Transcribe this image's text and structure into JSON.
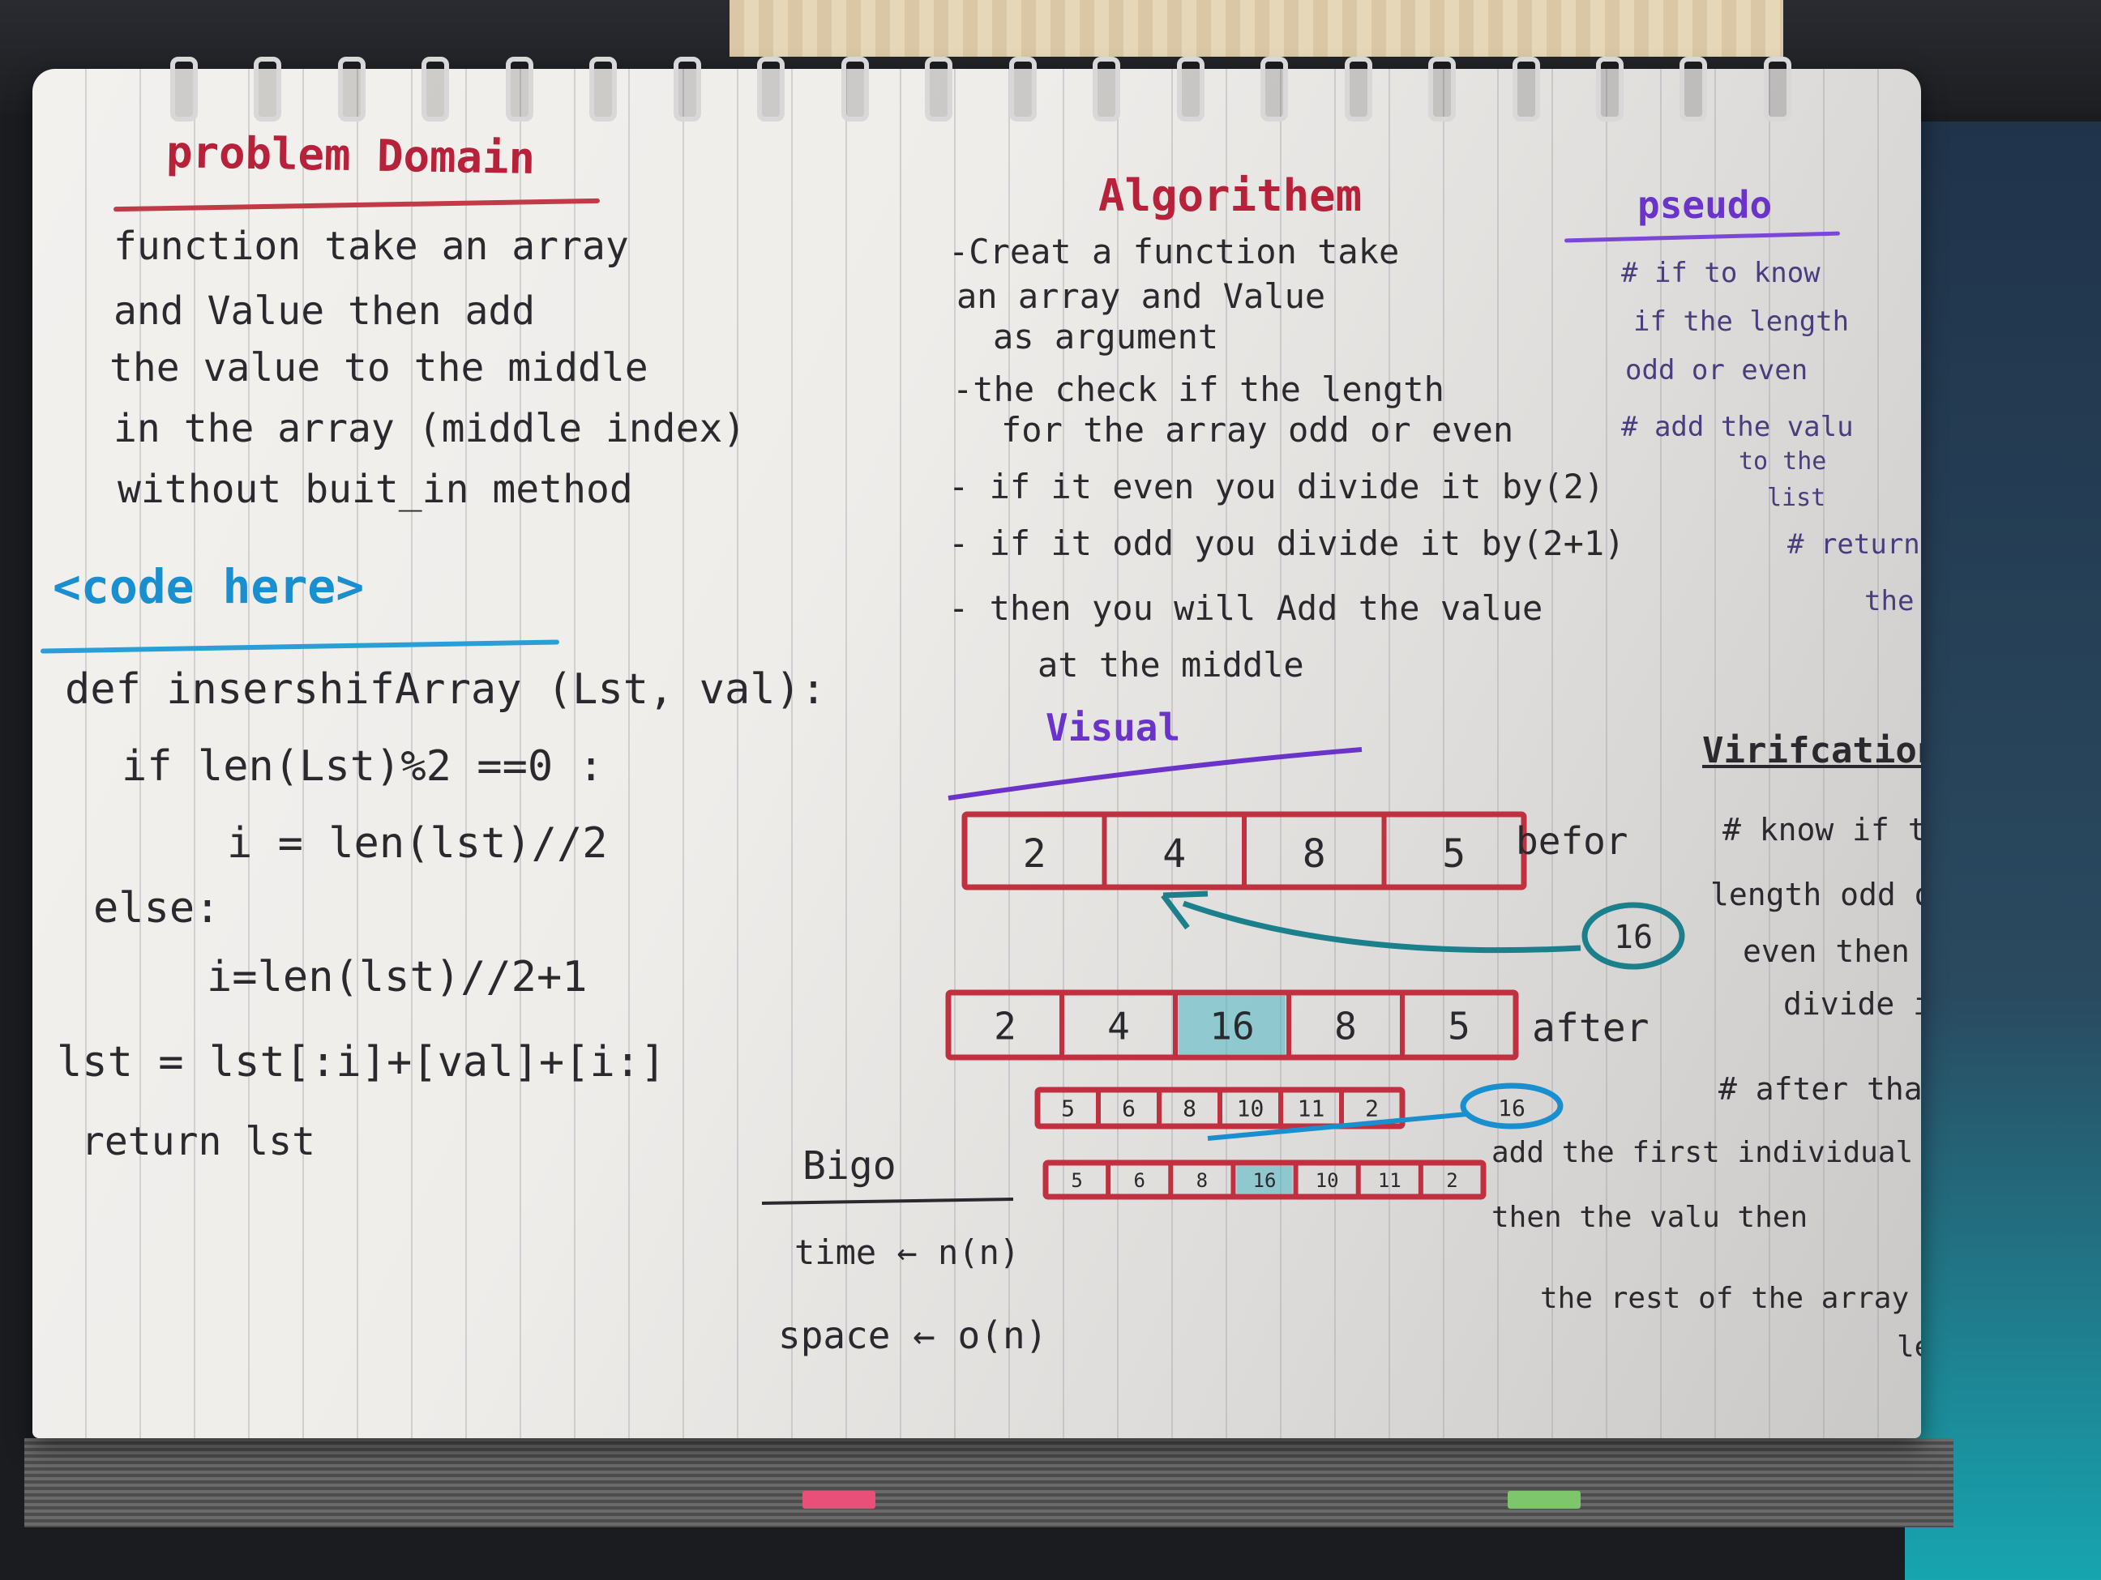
{
  "headings": {
    "problem": "problem Domain",
    "algorithm": "Algorithem",
    "pseudo": "pseudo",
    "code": "<code here>",
    "visual": "Visual",
    "verification": "Virifcation",
    "bigo": "Bigo"
  },
  "problem_lines": [
    "function take an array",
    "and Value then add",
    "the value to the middle",
    "in the array (middle index)",
    "without buit_in method"
  ],
  "code_lines": [
    "def insershifArray (Lst, val):",
    "if len(Lst)%2 ==0 :",
    "i = len(lst)//2",
    "else:",
    "i=len(lst)//2+1",
    "lst = lst[:i]+[val]+[i:]",
    "return lst"
  ],
  "algorithm_lines": [
    "-Creat a function take",
    "an array and Value",
    "as argument",
    "-the check if the length",
    "for the array odd or even",
    "- if it even you divide it by(2)",
    "- if it odd you divide it by(2+1)",
    "- then you will Add the value",
    "at the middle"
  ],
  "pseudo_lines": [
    "# if to know",
    "if the length",
    "odd or even",
    "# add the valu",
    "to the",
    "list",
    "# return",
    "the arr"
  ],
  "verification_lines": [
    "# know if the",
    "length odd or",
    "even then",
    "divide it",
    "# after that",
    "add the first individual",
    "then the valu then",
    "the rest of the array",
    "length"
  ],
  "visual": {
    "before_cells": [
      "2",
      "4",
      "8",
      "5"
    ],
    "after_cells": [
      "2",
      "4",
      "16",
      "8",
      "5"
    ],
    "insert_value": "16",
    "before_label": "befor",
    "after_label": "after",
    "small_before_cells": [
      "5",
      "6",
      "8",
      "10",
      "11",
      "2"
    ],
    "small_insert_value": "16",
    "small_after_cells": [
      "5",
      "6",
      "8",
      "16",
      "10",
      "11",
      "2"
    ]
  },
  "bigo": {
    "time": "time ← n(n)",
    "space": "space ← o(n)"
  },
  "colors": {
    "red": "#c0303e",
    "purple": "#6a33c9",
    "blue": "#1a8fcf",
    "teal": "#1c7f8c",
    "ink": "#2a2a2e"
  }
}
